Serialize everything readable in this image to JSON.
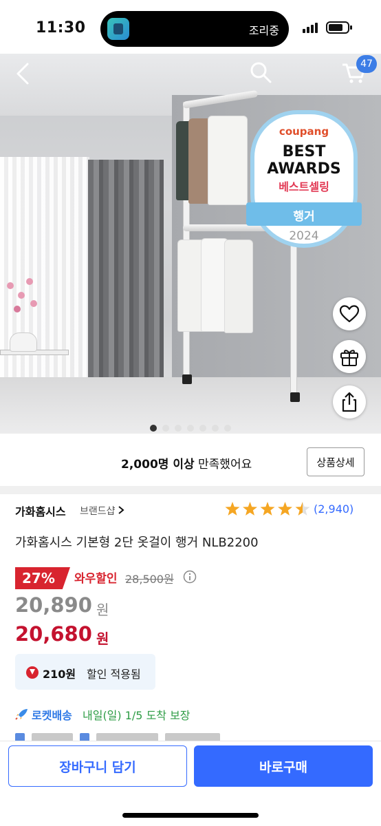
{
  "status_bar": {
    "time": "11:30",
    "island_text": "조리중"
  },
  "hero": {
    "award": {
      "logo": "coupang",
      "line1": "BEST",
      "line2": "AWARDS",
      "label_kr": "베스트셀링",
      "category": "행거",
      "year": "2024"
    },
    "cart_count": "47",
    "slides_total": 7,
    "slide_active": 1
  },
  "satisfaction": {
    "bold": "2,000명 이상",
    "rest": "만족했어요",
    "detail_button": "상품상세"
  },
  "product": {
    "brand": "가화홈시스",
    "brand_shop": "브랜드샵",
    "rating": 4.5,
    "rating_count": "(2,940)",
    "title": "가화홈시스 기본형 2단 옷걸이 행거 NLB2200"
  },
  "pricing": {
    "discount_pct": "27%",
    "discount_label": "와우할인",
    "original_price": "28,500원",
    "price_regular": "20,890",
    "price_final": "20,680",
    "currency": "원",
    "coupon_amount": "210원",
    "coupon_label": "할인 적용됨"
  },
  "delivery": {
    "type": "로켓배송",
    "eta": "내일(일) 1/5 도착 보장"
  },
  "bottom_bar": {
    "cart_button": "장바구니 담기",
    "buy_button": "바로구매"
  },
  "colors": {
    "accent": "#346aff",
    "sale_red": "#d8242f",
    "price_red": "#c4122f",
    "rocket_blue": "#2f79e6",
    "eta_green": "#2e9c45"
  }
}
